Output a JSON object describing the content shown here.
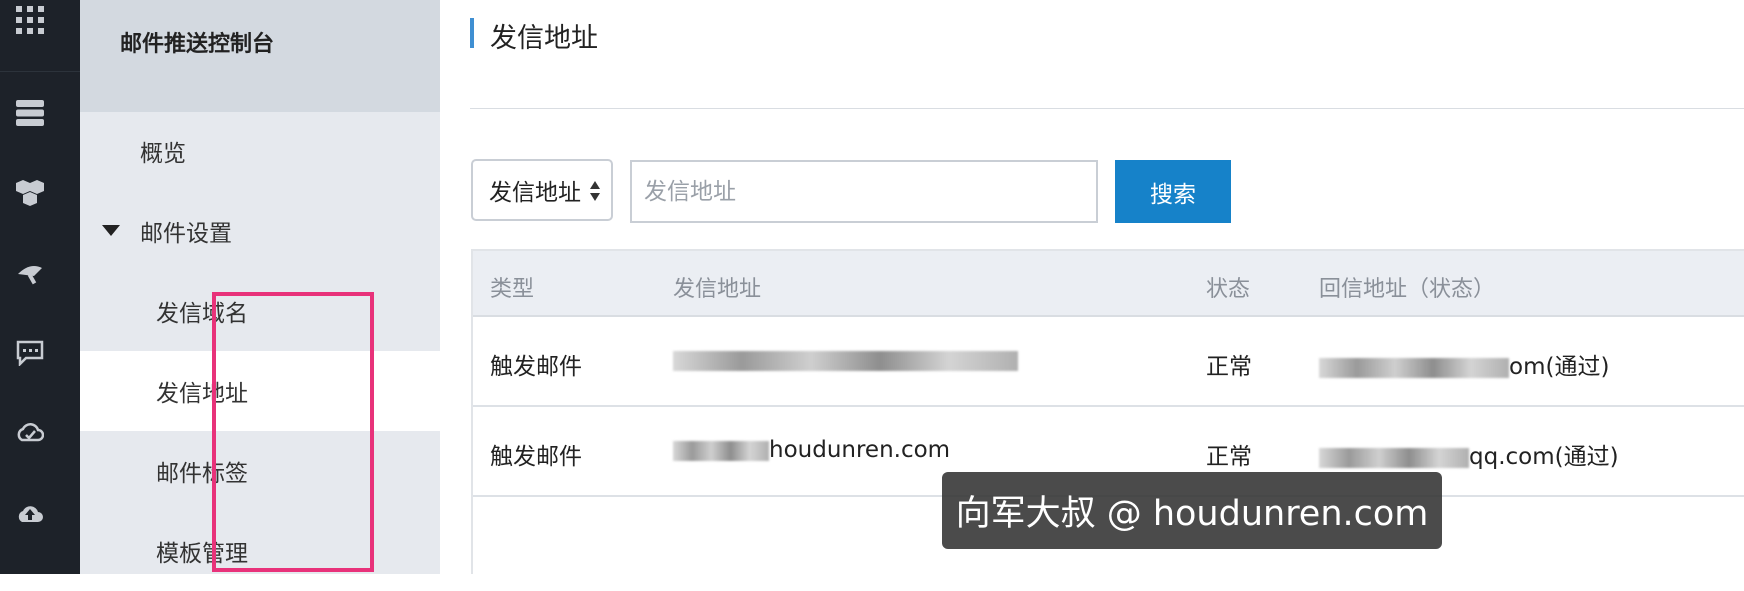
{
  "sidebar": {
    "title": "邮件推送控制台",
    "items": [
      {
        "label": "概览"
      },
      {
        "label": "邮件设置"
      },
      {
        "label": "发信域名"
      },
      {
        "label": "发信地址"
      },
      {
        "label": "邮件标签"
      },
      {
        "label": "模板管理"
      }
    ]
  },
  "main": {
    "page_title": "发信地址",
    "search": {
      "type_selected": "发信地址",
      "placeholder": "发信地址",
      "button_label": "搜索"
    },
    "table": {
      "columns": [
        "类型",
        "发信地址",
        "状态",
        "回信地址（状态）"
      ],
      "rows": [
        {
          "type": "触发邮件",
          "address_visible": "",
          "status": "正常",
          "reply_visible": "om(通过)"
        },
        {
          "type": "触发邮件",
          "address_visible": "houdunren.com",
          "status": "正常",
          "reply_visible": "qq.com(通过)"
        }
      ]
    }
  },
  "watermark": "向军大叔 @ houdunren.com",
  "colors": {
    "rail_bg": "#1d2229",
    "sidebar_bg": "#e6e9ee",
    "sidebar_header_bg": "#d3d9e0",
    "accent": "#1682c9",
    "highlight": "#e8327a"
  }
}
